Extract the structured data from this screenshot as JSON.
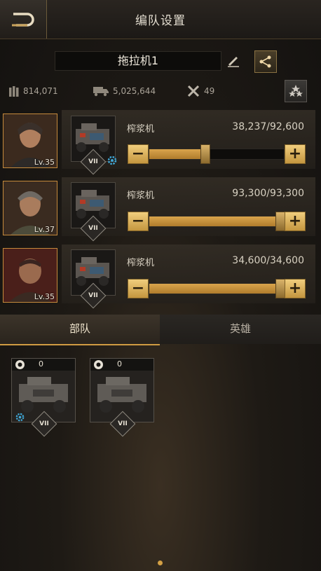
{
  "header": {
    "title": "编队设置",
    "back_icon": "back-arrow-icon"
  },
  "formation": {
    "name": "拖拉机1",
    "edit_icon": "pencil-icon",
    "share_icon": "share-icon"
  },
  "stats": {
    "ammo": "814,071",
    "transport": "5,025,644",
    "tools": "49",
    "star_icon": "three-stars-icon"
  },
  "rows": [
    {
      "hero_level": "Lv.35",
      "unit_name": "榨浆机",
      "unit_tier": "VII",
      "count": "38,237/92,600",
      "fill": 0.413,
      "has_gear": true
    },
    {
      "hero_level": "Lv.37",
      "unit_name": "榨浆机",
      "unit_tier": "VII",
      "count": "93,300/93,300",
      "fill": 1.0,
      "has_gear": false
    },
    {
      "hero_level": "Lv.35",
      "unit_name": "榨浆机",
      "unit_tier": "VII",
      "count": "34,600/34,600",
      "fill": 1.0,
      "has_gear": false
    }
  ],
  "tabs": {
    "troops": "部队",
    "heroes": "英雄",
    "active": "troops"
  },
  "cards": [
    {
      "count": "0",
      "tier": "VII",
      "has_gear": true
    },
    {
      "count": "0",
      "tier": "VII",
      "has_gear": false
    }
  ],
  "colors": {
    "accent": "#d09b42",
    "slider_fill": "#c8913c",
    "hero_border": "#c58a3c"
  }
}
